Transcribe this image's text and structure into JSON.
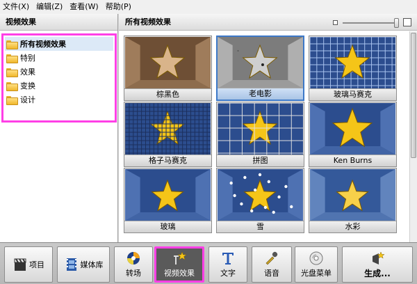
{
  "menu": [
    {
      "label": "文件(X)"
    },
    {
      "label": "编辑(Z)"
    },
    {
      "label": "查看(W)"
    },
    {
      "label": "帮助(P)"
    }
  ],
  "left_panel": {
    "title": "视频效果",
    "items": [
      {
        "label": "所有视频效果",
        "selected": true
      },
      {
        "label": "特别",
        "selected": false
      },
      {
        "label": "效果",
        "selected": false
      },
      {
        "label": "变换",
        "selected": false
      },
      {
        "label": "设计",
        "selected": false
      }
    ]
  },
  "right_panel": {
    "title": "所有视频效果",
    "effects": [
      {
        "label": "棕黑色",
        "style": "sepia",
        "selected": false
      },
      {
        "label": "老电影",
        "style": "oldfilm",
        "selected": true
      },
      {
        "label": "玻璃马赛克",
        "style": "glassmosaic",
        "selected": false
      },
      {
        "label": "格子马赛克",
        "style": "gridmosaic",
        "selected": false
      },
      {
        "label": "拼图",
        "style": "puzzle",
        "selected": false
      },
      {
        "label": "Ken Burns",
        "style": "kenburns",
        "selected": false
      },
      {
        "label": "玻璃",
        "style": "glass",
        "selected": false
      },
      {
        "label": "雪",
        "style": "snow",
        "selected": false
      },
      {
        "label": "水彩",
        "style": "watercolor",
        "selected": false
      }
    ]
  },
  "toolbar": {
    "buttons": [
      {
        "label": "项目",
        "icon": "clapperboard-icon"
      },
      {
        "label": "媒体库",
        "icon": "film-strip-icon"
      },
      {
        "label": "转场",
        "icon": "transition-swirl-icon"
      },
      {
        "label": "视频效果",
        "icon": "magic-wand-icon",
        "active": true
      },
      {
        "label": "文字",
        "icon": "text-t-icon"
      },
      {
        "label": "语音",
        "icon": "microphone-icon"
      },
      {
        "label": "光盘菜单",
        "icon": "disc-menu-icon"
      },
      {
        "label": "生成...",
        "icon": "produce-icon"
      }
    ]
  },
  "colors": {
    "highlight": "#ff3fe6",
    "selection": "#3c78c8",
    "star": "#f5c518",
    "blue_bg": "#2c4d8e"
  }
}
